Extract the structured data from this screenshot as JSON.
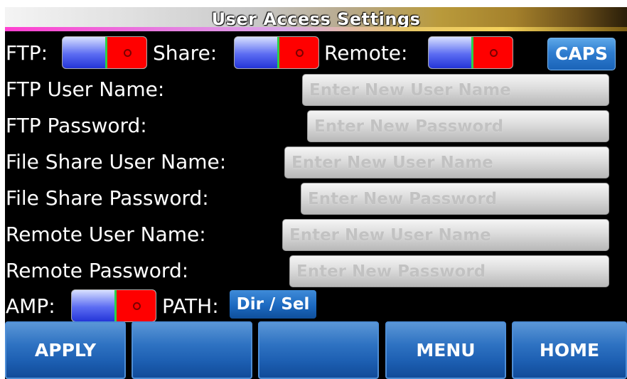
{
  "title": "User Access Settings",
  "toggles_row": {
    "ftp_label": "FTP:",
    "share_label": "Share:",
    "remote_label": "Remote:",
    "caps_label": "CAPS"
  },
  "fields": [
    {
      "label": "FTP User Name:",
      "placeholder": "Enter New User Name"
    },
    {
      "label": "FTP Password:",
      "placeholder": "Enter New Password"
    },
    {
      "label": "File Share User Name:",
      "placeholder": "Enter New User Name"
    },
    {
      "label": "File Share Password:",
      "placeholder": "Enter New Password"
    },
    {
      "label": "Remote User Name:",
      "placeholder": "Enter New User Name"
    },
    {
      "label": "Remote Password:",
      "placeholder": "Enter New Password"
    }
  ],
  "bottom_row": {
    "amp_label": "AMP:",
    "path_label": "PATH:",
    "dir_button": "Dir / Sel"
  },
  "footer": {
    "buttons": [
      "APPLY",
      "",
      "",
      "MENU",
      "HOME"
    ]
  },
  "colors": {
    "toggle_on": "#2435d8",
    "toggle_off": "#ff0000",
    "button_blue": "#1d5fb2"
  }
}
